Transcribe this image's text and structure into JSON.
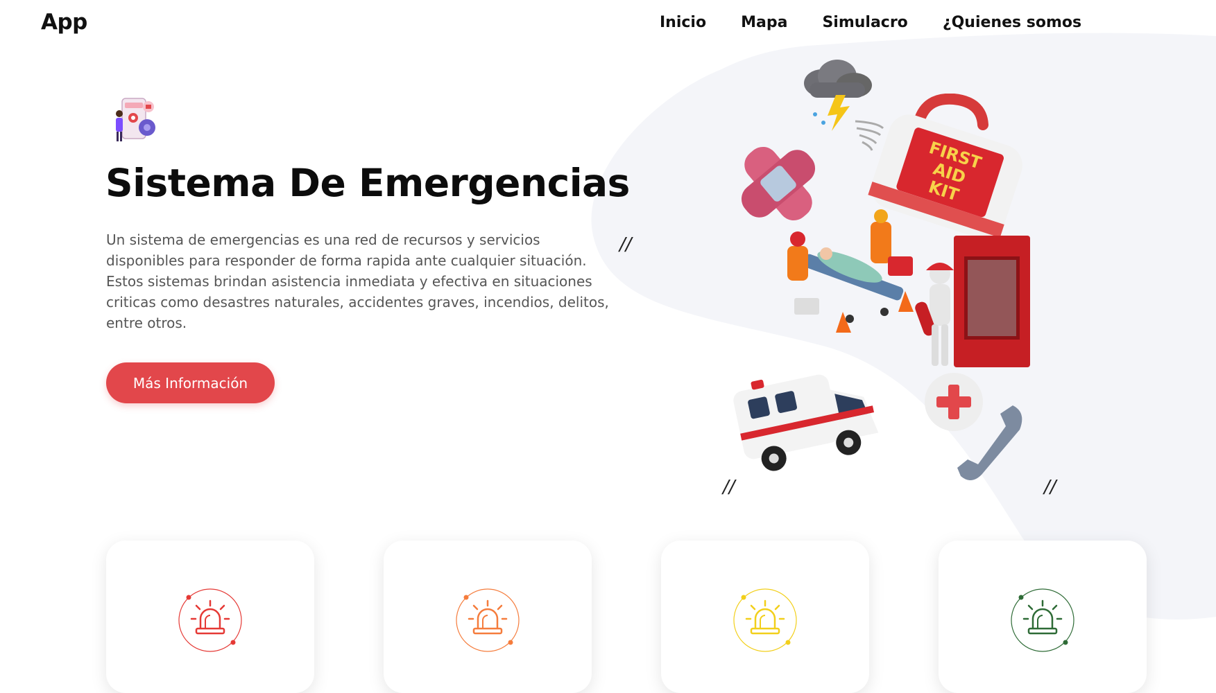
{
  "app": {
    "title": "App"
  },
  "nav": {
    "items": [
      "Inicio",
      "Mapa",
      "Simulacro",
      "¿Quienes somos"
    ]
  },
  "hero": {
    "title": "Sistema De Emergencias",
    "description": "Un sistema de emergencias es una red de recursos y servicios disponibles para responder de forma rapida ante cualquier situación. Estos sistemas brindan asistencia inmediata y efectiva en situaciones criticas como desastres naturales, accidentes graves, incendios, delitos, entre otros.",
    "button_label": "Más Información",
    "deco_mark": "//"
  },
  "illustration": {
    "kit_label_lines": [
      "FIRST",
      "AID",
      "KIT"
    ],
    "items": [
      "storm-cloud",
      "bandage",
      "first-aid-kit",
      "paramedics-stretcher",
      "firefighter-extinguisher",
      "ambulance",
      "emergency-phone"
    ]
  },
  "cards": [
    {
      "icon": "siren-icon",
      "color": "#e53935"
    },
    {
      "icon": "siren-icon",
      "color": "#f57c3c"
    },
    {
      "icon": "siren-icon",
      "color": "#f2cf1a"
    },
    {
      "icon": "siren-icon",
      "color": "#2e6b36"
    }
  ],
  "colors": {
    "accent": "#e2474b",
    "blob": "#f4f5f9"
  }
}
